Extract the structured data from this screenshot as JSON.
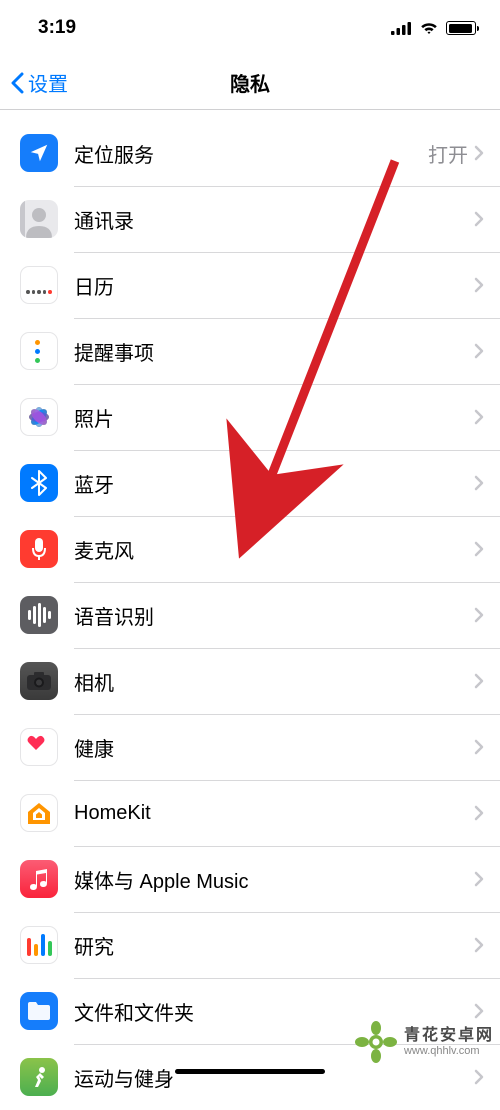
{
  "status": {
    "time": "3:19"
  },
  "nav": {
    "back_label": "设置",
    "title": "隐私"
  },
  "rows": [
    {
      "key": "location",
      "label": "定位服务",
      "value": "打开"
    },
    {
      "key": "contacts",
      "label": "通讯录",
      "value": ""
    },
    {
      "key": "calendar",
      "label": "日历",
      "value": ""
    },
    {
      "key": "reminders",
      "label": "提醒事项",
      "value": ""
    },
    {
      "key": "photos",
      "label": "照片",
      "value": ""
    },
    {
      "key": "bluetooth",
      "label": "蓝牙",
      "value": ""
    },
    {
      "key": "microphone",
      "label": "麦克风",
      "value": ""
    },
    {
      "key": "speech",
      "label": "语音识别",
      "value": ""
    },
    {
      "key": "camera",
      "label": "相机",
      "value": ""
    },
    {
      "key": "health",
      "label": "健康",
      "value": ""
    },
    {
      "key": "homekit",
      "label": "HomeKit",
      "value": ""
    },
    {
      "key": "music",
      "label": "媒体与 Apple Music",
      "value": ""
    },
    {
      "key": "research",
      "label": "研究",
      "value": ""
    },
    {
      "key": "files",
      "label": "文件和文件夹",
      "value": ""
    },
    {
      "key": "motion",
      "label": "运动与健身",
      "value": ""
    }
  ],
  "watermark": {
    "name": "青花安卓网",
    "url": "www.qhhlv.com"
  },
  "annotation": {
    "arrow_color": "#d62027"
  }
}
